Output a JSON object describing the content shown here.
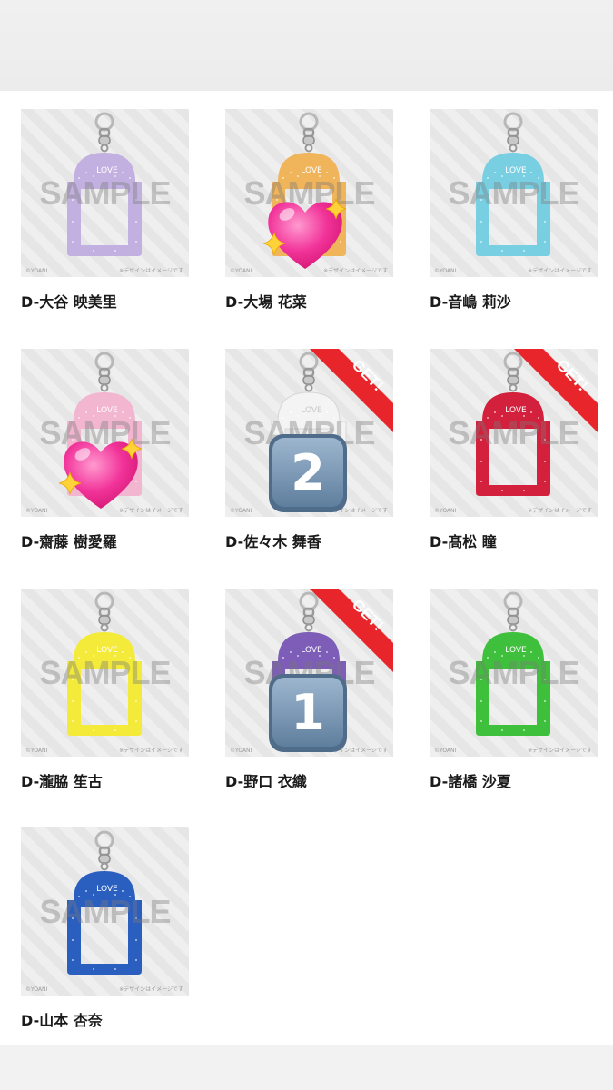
{
  "items": [
    {
      "name": "D-大谷 映美里",
      "color": "#c2b0e0",
      "charm_label": "LOVE",
      "watermark": "SAMPLE",
      "copyright": "©YOANI",
      "note": "※デザインはイメージです",
      "got": false,
      "badge": "none"
    },
    {
      "name": "D-大場 花菜",
      "color": "#f0b45a",
      "charm_label": "LOVE",
      "watermark": "SAMPLE",
      "copyright": "©YOANI",
      "note": "※デザインはイメージです",
      "got": false,
      "badge": "heart"
    },
    {
      "name": "D-音嶋 莉沙",
      "color": "#79cfe2",
      "charm_label": "LOVE",
      "watermark": "SAMPLE",
      "copyright": "©YOANI",
      "note": "※デザインはイメージです",
      "got": false,
      "badge": "none"
    },
    {
      "name": "D-齋藤 樹愛羅",
      "color": "#f3b6d0",
      "charm_label": "LOVE",
      "watermark": "SAMPLE",
      "copyright": "©YOANI",
      "note": "※デザインはイメージです",
      "got": false,
      "badge": "heart"
    },
    {
      "name": "D-佐々木 舞香",
      "color": "#f4f4f4",
      "charm_label": "LOVE",
      "watermark": "SAMPLE",
      "copyright": "©YOANI",
      "note": "※デザインはイメージです",
      "got": true,
      "badge": "keycap",
      "badge_number": "2"
    },
    {
      "name": "D-髙松 瞳",
      "color": "#d3203c",
      "charm_label": "LOVE",
      "watermark": "SAMPLE",
      "copyright": "©YOANI",
      "note": "※デザインはイメージです",
      "got": true,
      "badge": "none"
    },
    {
      "name": "D-瀧脇 笙古",
      "color": "#f3ea3a",
      "charm_label": "LOVE",
      "watermark": "SAMPLE",
      "copyright": "©YOANI",
      "note": "※デザインはイメージです",
      "got": false,
      "badge": "none"
    },
    {
      "name": "D-野口 衣織",
      "color": "#7d5db8",
      "charm_label": "LOVE",
      "watermark": "SAMPLE",
      "copyright": "©YOANI",
      "note": "※デザインはイメージです",
      "got": true,
      "badge": "keycap",
      "badge_number": "1"
    },
    {
      "name": "D-諸橋 沙夏",
      "color": "#3fc03c",
      "charm_label": "LOVE",
      "watermark": "SAMPLE",
      "copyright": "©YOANI",
      "note": "※デザインはイメージです",
      "got": false,
      "badge": "none"
    },
    {
      "name": "D-山本 杏奈",
      "color": "#2a5fc0",
      "charm_label": "LOVE",
      "watermark": "SAMPLE",
      "copyright": "©YOANI",
      "note": "※デザインはイメージです",
      "got": false,
      "badge": "none"
    }
  ],
  "ribbon_text": "GET!",
  "ribbon_color": "#e8252a"
}
